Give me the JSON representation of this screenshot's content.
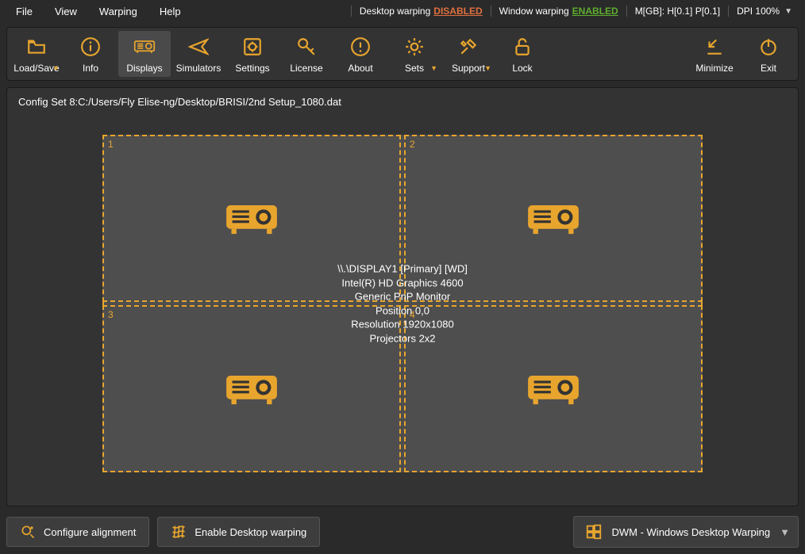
{
  "menubar": {
    "file": "File",
    "view": "View",
    "warping": "Warping",
    "help": "Help"
  },
  "status": {
    "desktop_warp_label": "Desktop warping",
    "desktop_warp_state": "DISABLED",
    "window_warp_label": "Window warping",
    "window_warp_state": "ENABLED",
    "mem": "M[GB]: H[0.1] P[0.1]",
    "dpi": "DPI 100%"
  },
  "toolbar": {
    "loadsave": "Load/Save",
    "info": "Info",
    "displays": "Displays",
    "simulators": "Simulators",
    "settings": "Settings",
    "license": "License",
    "about": "About",
    "sets": "Sets",
    "support": "Support",
    "lock": "Lock",
    "minimize": "Minimize",
    "exit": "Exit"
  },
  "main": {
    "config_path": "Config Set 8:C:/Users/Fly Elise-ng/Desktop/BRISI/2nd Setup_1080.dat",
    "cells": [
      "1",
      "2",
      "3",
      "4"
    ],
    "info_lines": [
      "\\\\.\\DISPLAY1 [Primary] [WD]",
      "Intel(R) HD Graphics 4600",
      "Generic PnP Monitor",
      "Position 0,0",
      "Resolution 1920x1080",
      "Projectors 2x2"
    ]
  },
  "bottom": {
    "configure_alignment": "Configure alignment",
    "enable_desktop_warping": "Enable Desktop warping",
    "mode_label": "DWM - Windows Desktop Warping"
  }
}
